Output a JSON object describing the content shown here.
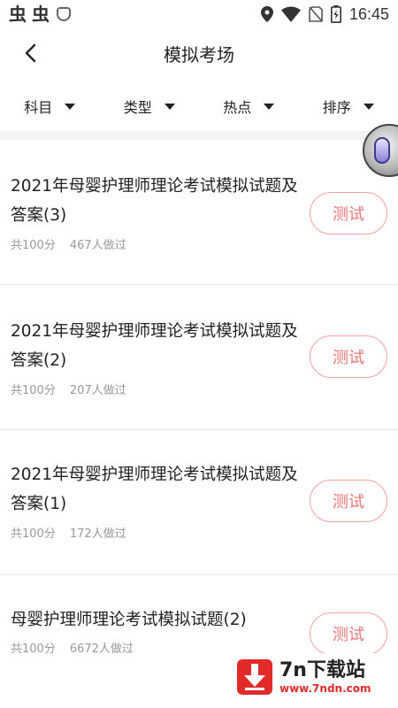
{
  "status_bar": {
    "left_glyphs": [
      "虫",
      "虫"
    ],
    "time": "16:45",
    "icons": [
      "location-icon",
      "wifi-icon",
      "no-sim-icon",
      "battery-charging-icon"
    ]
  },
  "header": {
    "back_icon": "chevron-left-icon",
    "title": "模拟考场"
  },
  "filters": [
    {
      "label": "科目"
    },
    {
      "label": "类型"
    },
    {
      "label": "热点"
    },
    {
      "label": "排序"
    }
  ],
  "exams": [
    {
      "title": "2021年母婴护理师理论考试模拟试题及答案(3)",
      "total": "共100分",
      "count": "467人做过",
      "action": "测试"
    },
    {
      "title": "2021年母婴护理师理论考试模拟试题及答案(2)",
      "total": "共100分",
      "count": "207人做过",
      "action": "测试"
    },
    {
      "title": "2021年母婴护理师理论考试模拟试题及答案(1)",
      "total": "共100分",
      "count": "172人做过",
      "action": "测试"
    },
    {
      "title": "母婴护理师理论考试模拟试题(2)",
      "total": "共100分",
      "count": "6672人做过",
      "action": "测试"
    }
  ],
  "watermark": {
    "name": "7n下载站",
    "url": "www.7ndn.com"
  },
  "colors": {
    "accent": "#ee7777",
    "button_border": "#f3a3a3",
    "meta_text": "#999999",
    "watermark_red": "#e32a2a"
  }
}
